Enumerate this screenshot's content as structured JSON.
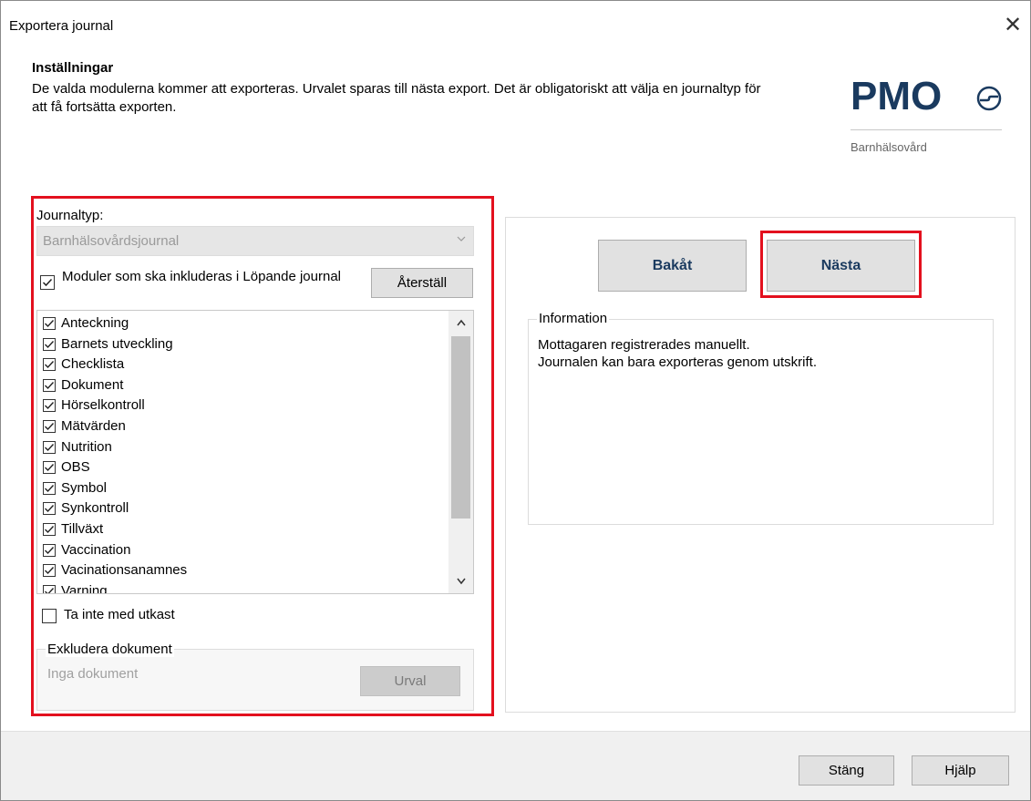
{
  "window": {
    "title": "Exportera journal",
    "close_glyph": "✕"
  },
  "header": {
    "heading": "Inställningar",
    "description": "De valda modulerna kommer att exporteras. Urvalet sparas till nästa export. Det är obligatoriskt att välja en journaltyp för att få fortsätta exporten."
  },
  "logo": {
    "brand": "PMO",
    "subtitle": "Barnhälsovård",
    "brand_color": "#1a3a5f"
  },
  "journaltyp": {
    "label": "Journaltyp:",
    "selected": "Barnhälsovårdsjournal"
  },
  "modules": {
    "toggle_label": "Moduler som ska inkluderas i Löpande journal",
    "toggle_checked": true,
    "reset_label": "Återställ",
    "items": [
      {
        "label": "Anteckning",
        "checked": true
      },
      {
        "label": "Barnets utveckling",
        "checked": true
      },
      {
        "label": "Checklista",
        "checked": true
      },
      {
        "label": "Dokument",
        "checked": true
      },
      {
        "label": "Hörselkontroll",
        "checked": true
      },
      {
        "label": "Mätvärden",
        "checked": true
      },
      {
        "label": "Nutrition",
        "checked": true
      },
      {
        "label": "OBS",
        "checked": true
      },
      {
        "label": "Symbol",
        "checked": true
      },
      {
        "label": "Synkontroll",
        "checked": true
      },
      {
        "label": "Tillväxt",
        "checked": true
      },
      {
        "label": "Vaccination",
        "checked": true
      },
      {
        "label": "Vacinationsanamnes",
        "checked": true
      },
      {
        "label": "Varning",
        "checked": true
      }
    ]
  },
  "drafts": {
    "label": "Ta inte med utkast",
    "checked": false
  },
  "exclude": {
    "legend": "Exkludera dokument",
    "empty_text": "Inga dokument",
    "select_label": "Urval"
  },
  "nav": {
    "back_label": "Bakåt",
    "next_label": "Nästa"
  },
  "info": {
    "legend": "Information",
    "line1": "Mottagaren registrerades manuellt.",
    "line2": "Journalen kan bara exporteras genom utskrift."
  },
  "footer": {
    "close_label": "Stäng",
    "help_label": "Hjälp"
  },
  "colors": {
    "highlight": "#e3101e",
    "accent_text": "#1a3a5f"
  }
}
